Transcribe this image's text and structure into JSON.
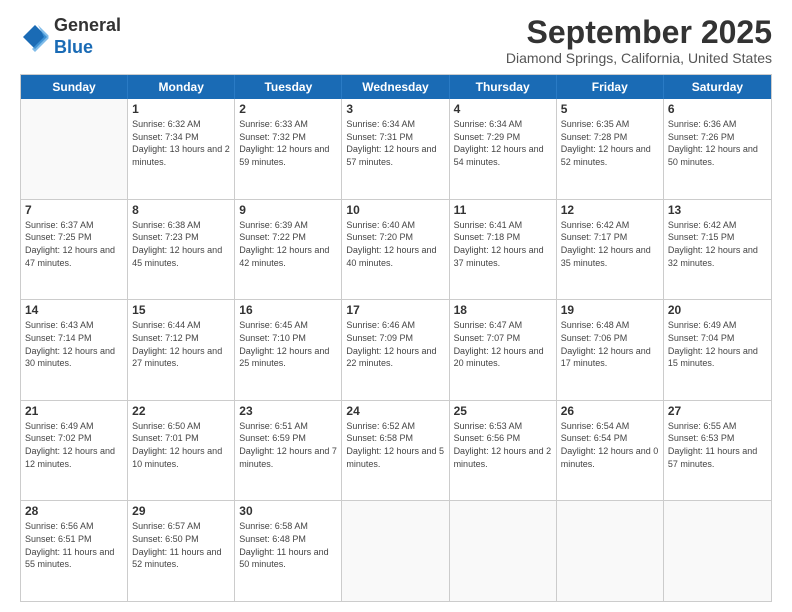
{
  "logo": {
    "line1": "General",
    "line2": "Blue"
  },
  "title": "September 2025",
  "subtitle": "Diamond Springs, California, United States",
  "dayHeaders": [
    "Sunday",
    "Monday",
    "Tuesday",
    "Wednesday",
    "Thursday",
    "Friday",
    "Saturday"
  ],
  "weeks": [
    [
      {
        "date": "",
        "sunrise": "",
        "sunset": "",
        "daylight": "",
        "empty": true
      },
      {
        "date": "1",
        "sunrise": "Sunrise: 6:32 AM",
        "sunset": "Sunset: 7:34 PM",
        "daylight": "Daylight: 13 hours and 2 minutes."
      },
      {
        "date": "2",
        "sunrise": "Sunrise: 6:33 AM",
        "sunset": "Sunset: 7:32 PM",
        "daylight": "Daylight: 12 hours and 59 minutes."
      },
      {
        "date": "3",
        "sunrise": "Sunrise: 6:34 AM",
        "sunset": "Sunset: 7:31 PM",
        "daylight": "Daylight: 12 hours and 57 minutes."
      },
      {
        "date": "4",
        "sunrise": "Sunrise: 6:34 AM",
        "sunset": "Sunset: 7:29 PM",
        "daylight": "Daylight: 12 hours and 54 minutes."
      },
      {
        "date": "5",
        "sunrise": "Sunrise: 6:35 AM",
        "sunset": "Sunset: 7:28 PM",
        "daylight": "Daylight: 12 hours and 52 minutes."
      },
      {
        "date": "6",
        "sunrise": "Sunrise: 6:36 AM",
        "sunset": "Sunset: 7:26 PM",
        "daylight": "Daylight: 12 hours and 50 minutes."
      }
    ],
    [
      {
        "date": "7",
        "sunrise": "Sunrise: 6:37 AM",
        "sunset": "Sunset: 7:25 PM",
        "daylight": "Daylight: 12 hours and 47 minutes."
      },
      {
        "date": "8",
        "sunrise": "Sunrise: 6:38 AM",
        "sunset": "Sunset: 7:23 PM",
        "daylight": "Daylight: 12 hours and 45 minutes."
      },
      {
        "date": "9",
        "sunrise": "Sunrise: 6:39 AM",
        "sunset": "Sunset: 7:22 PM",
        "daylight": "Daylight: 12 hours and 42 minutes."
      },
      {
        "date": "10",
        "sunrise": "Sunrise: 6:40 AM",
        "sunset": "Sunset: 7:20 PM",
        "daylight": "Daylight: 12 hours and 40 minutes."
      },
      {
        "date": "11",
        "sunrise": "Sunrise: 6:41 AM",
        "sunset": "Sunset: 7:18 PM",
        "daylight": "Daylight: 12 hours and 37 minutes."
      },
      {
        "date": "12",
        "sunrise": "Sunrise: 6:42 AM",
        "sunset": "Sunset: 7:17 PM",
        "daylight": "Daylight: 12 hours and 35 minutes."
      },
      {
        "date": "13",
        "sunrise": "Sunrise: 6:42 AM",
        "sunset": "Sunset: 7:15 PM",
        "daylight": "Daylight: 12 hours and 32 minutes."
      }
    ],
    [
      {
        "date": "14",
        "sunrise": "Sunrise: 6:43 AM",
        "sunset": "Sunset: 7:14 PM",
        "daylight": "Daylight: 12 hours and 30 minutes."
      },
      {
        "date": "15",
        "sunrise": "Sunrise: 6:44 AM",
        "sunset": "Sunset: 7:12 PM",
        "daylight": "Daylight: 12 hours and 27 minutes."
      },
      {
        "date": "16",
        "sunrise": "Sunrise: 6:45 AM",
        "sunset": "Sunset: 7:10 PM",
        "daylight": "Daylight: 12 hours and 25 minutes."
      },
      {
        "date": "17",
        "sunrise": "Sunrise: 6:46 AM",
        "sunset": "Sunset: 7:09 PM",
        "daylight": "Daylight: 12 hours and 22 minutes."
      },
      {
        "date": "18",
        "sunrise": "Sunrise: 6:47 AM",
        "sunset": "Sunset: 7:07 PM",
        "daylight": "Daylight: 12 hours and 20 minutes."
      },
      {
        "date": "19",
        "sunrise": "Sunrise: 6:48 AM",
        "sunset": "Sunset: 7:06 PM",
        "daylight": "Daylight: 12 hours and 17 minutes."
      },
      {
        "date": "20",
        "sunrise": "Sunrise: 6:49 AM",
        "sunset": "Sunset: 7:04 PM",
        "daylight": "Daylight: 12 hours and 15 minutes."
      }
    ],
    [
      {
        "date": "21",
        "sunrise": "Sunrise: 6:49 AM",
        "sunset": "Sunset: 7:02 PM",
        "daylight": "Daylight: 12 hours and 12 minutes."
      },
      {
        "date": "22",
        "sunrise": "Sunrise: 6:50 AM",
        "sunset": "Sunset: 7:01 PM",
        "daylight": "Daylight: 12 hours and 10 minutes."
      },
      {
        "date": "23",
        "sunrise": "Sunrise: 6:51 AM",
        "sunset": "Sunset: 6:59 PM",
        "daylight": "Daylight: 12 hours and 7 minutes."
      },
      {
        "date": "24",
        "sunrise": "Sunrise: 6:52 AM",
        "sunset": "Sunset: 6:58 PM",
        "daylight": "Daylight: 12 hours and 5 minutes."
      },
      {
        "date": "25",
        "sunrise": "Sunrise: 6:53 AM",
        "sunset": "Sunset: 6:56 PM",
        "daylight": "Daylight: 12 hours and 2 minutes."
      },
      {
        "date": "26",
        "sunrise": "Sunrise: 6:54 AM",
        "sunset": "Sunset: 6:54 PM",
        "daylight": "Daylight: 12 hours and 0 minutes."
      },
      {
        "date": "27",
        "sunrise": "Sunrise: 6:55 AM",
        "sunset": "Sunset: 6:53 PM",
        "daylight": "Daylight: 11 hours and 57 minutes."
      }
    ],
    [
      {
        "date": "28",
        "sunrise": "Sunrise: 6:56 AM",
        "sunset": "Sunset: 6:51 PM",
        "daylight": "Daylight: 11 hours and 55 minutes."
      },
      {
        "date": "29",
        "sunrise": "Sunrise: 6:57 AM",
        "sunset": "Sunset: 6:50 PM",
        "daylight": "Daylight: 11 hours and 52 minutes."
      },
      {
        "date": "30",
        "sunrise": "Sunrise: 6:58 AM",
        "sunset": "Sunset: 6:48 PM",
        "daylight": "Daylight: 11 hours and 50 minutes."
      },
      {
        "date": "",
        "sunrise": "",
        "sunset": "",
        "daylight": "",
        "empty": true
      },
      {
        "date": "",
        "sunrise": "",
        "sunset": "",
        "daylight": "",
        "empty": true
      },
      {
        "date": "",
        "sunrise": "",
        "sunset": "",
        "daylight": "",
        "empty": true
      },
      {
        "date": "",
        "sunrise": "",
        "sunset": "",
        "daylight": "",
        "empty": true
      }
    ]
  ]
}
